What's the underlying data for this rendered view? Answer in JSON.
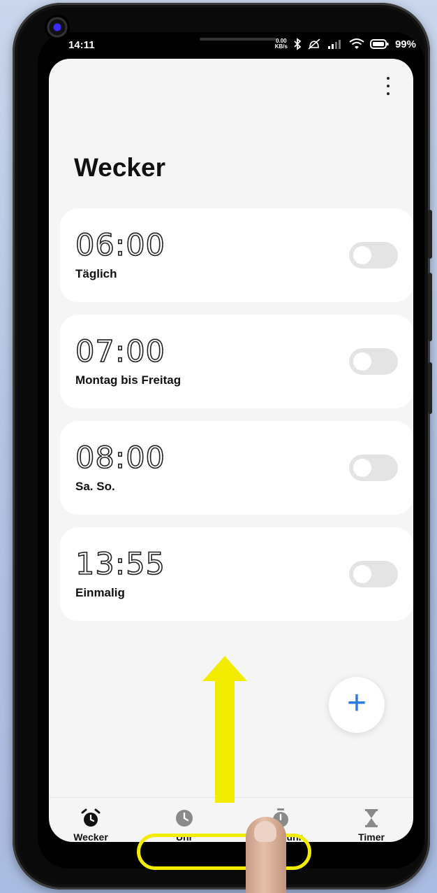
{
  "statusbar": {
    "time": "14:11",
    "net_speed": "0.00",
    "net_unit": "KB/s",
    "battery": "99%"
  },
  "header": {
    "title": "Wecker",
    "menu_icon": "more-vert-icon"
  },
  "alarms": [
    {
      "time": "06:00",
      "label": "Täglich",
      "enabled": false
    },
    {
      "time": "07:00",
      "label": "Montag bis Freitag",
      "enabled": false
    },
    {
      "time": "08:00",
      "label": "Sa. So.",
      "enabled": false
    },
    {
      "time": "13:55",
      "label": "Einmalig",
      "enabled": false
    }
  ],
  "fab": {
    "label": "+",
    "icon": "plus-icon"
  },
  "nav": {
    "items": [
      {
        "label": "Wecker",
        "icon": "alarm-clock-icon",
        "active": true
      },
      {
        "label": "Uhr",
        "icon": "clock-icon",
        "active": false
      },
      {
        "label": "Stoppuhr",
        "icon": "stopwatch-icon",
        "active": false
      },
      {
        "label": "Timer",
        "icon": "hourglass-icon",
        "active": false
      }
    ]
  },
  "overlay": {
    "arrow_color": "#f2ec00",
    "highlight_color": "#f2ec00"
  },
  "colors": {
    "accent": "#2a7be4",
    "card": "#ffffff",
    "background": "#f5f5f5"
  }
}
